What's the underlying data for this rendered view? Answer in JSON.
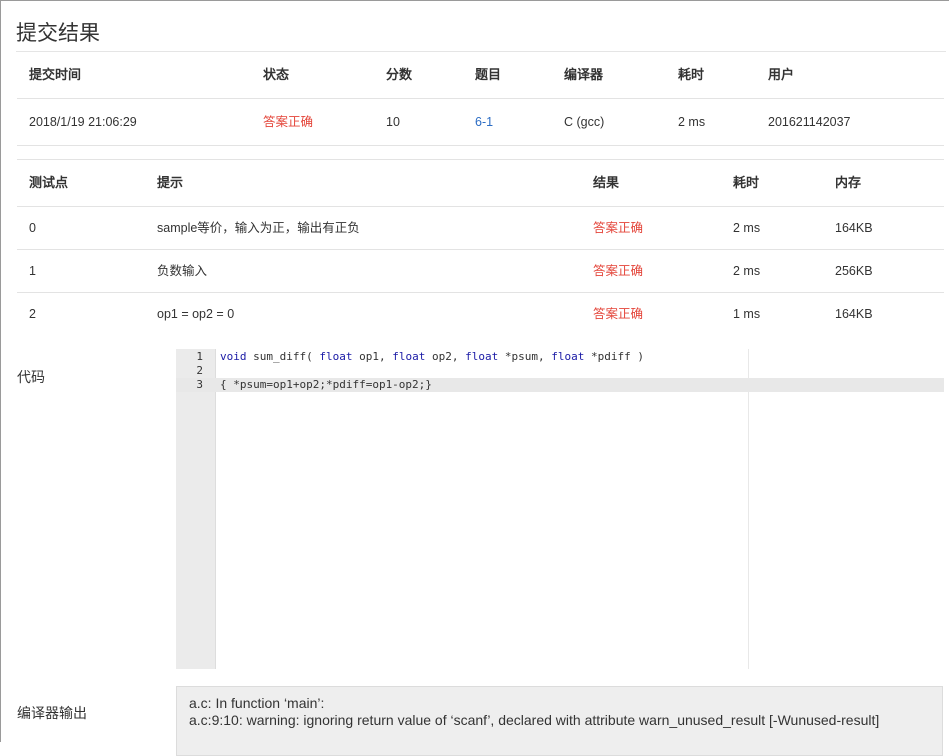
{
  "page": {
    "title": "提交结果"
  },
  "summary": {
    "headers": [
      "提交时间",
      "状态",
      "分数",
      "题目",
      "编译器",
      "耗时",
      "用户"
    ],
    "row": {
      "time": "2018/1/19 21:06:29",
      "status": "答案正确",
      "score": "10",
      "problem": "6-1",
      "compiler": "C (gcc)",
      "duration": "2 ms",
      "user": "201621142037"
    }
  },
  "cases": {
    "headers": [
      "测试点",
      "提示",
      "结果",
      "耗时",
      "内存"
    ],
    "rows": [
      {
        "id": "0",
        "hint": "sample等价，输入为正，输出有正负",
        "result": "答案正确",
        "time": "2 ms",
        "memory": "164KB"
      },
      {
        "id": "1",
        "hint": "负数输入",
        "result": "答案正确",
        "time": "2 ms",
        "memory": "256KB"
      },
      {
        "id": "2",
        "hint": "op1 = op2 = 0",
        "result": "答案正确",
        "time": "1 ms",
        "memory": "164KB"
      }
    ]
  },
  "code": {
    "label": "代码",
    "lines": [
      {
        "num": "1",
        "text": "void sum_diff( float op1, float op2, float *psum, float *pdiff )"
      },
      {
        "num": "2",
        "text": ""
      },
      {
        "num": "3",
        "text": "{ *psum=op1+op2;*pdiff=op1-op2;}"
      }
    ],
    "active_line": 3
  },
  "compiler_output": {
    "label": "编译器输出",
    "lines": [
      "a.c: In function ‘main’:",
      "a.c:9:10: warning: ignoring return value of ‘scanf’, declared with attribute warn_unused_result [-Wunused-result]"
    ]
  },
  "colors": {
    "accepted": "#e4453a",
    "link": "#2b6cc4",
    "keyword": "#1a1aa6"
  }
}
